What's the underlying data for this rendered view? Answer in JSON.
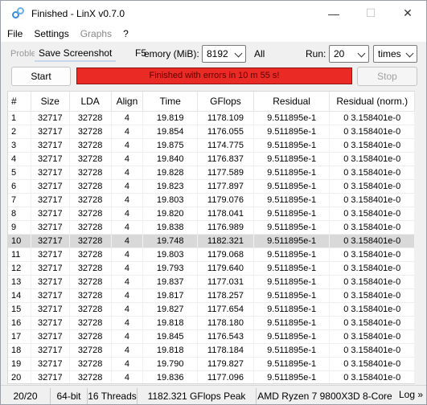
{
  "window": {
    "title": "Finished - LinX v0.7.0",
    "controls": {
      "minimize": "—",
      "maximize": "☐",
      "close": "✕"
    }
  },
  "menu": [
    "File",
    "Settings",
    "Graphs",
    "?"
  ],
  "toolbar": {
    "ghost_left": "Proble",
    "save_screenshot": "Save Screenshot",
    "shortcut": "F5",
    "memory_label": "emory (MiB):",
    "memory_value": "8192",
    "all_label": "All",
    "run_label": "Run:",
    "run_value": "20",
    "times_value": "times"
  },
  "actions": {
    "start": "Start",
    "status": "Finished with errors in 10 m 55 s!",
    "stop": "Stop"
  },
  "table": {
    "headers": [
      "#",
      "Size",
      "LDA",
      "Align",
      "Time",
      "GFlops",
      "Residual",
      "Residual (norm.)"
    ],
    "selected_row": 10,
    "rows": [
      [
        "1",
        "32717",
        "32728",
        "4",
        "19.819",
        "1178.109",
        "9.511895e-1",
        "0 3.158401e-0"
      ],
      [
        "2",
        "32717",
        "32728",
        "4",
        "19.854",
        "1176.055",
        "9.511895e-1",
        "0 3.158401e-0"
      ],
      [
        "3",
        "32717",
        "32728",
        "4",
        "19.875",
        "1174.775",
        "9.511895e-1",
        "0 3.158401e-0"
      ],
      [
        "4",
        "32717",
        "32728",
        "4",
        "19.840",
        "1176.837",
        "9.511895e-1",
        "0 3.158401e-0"
      ],
      [
        "5",
        "32717",
        "32728",
        "4",
        "19.828",
        "1177.589",
        "9.511895e-1",
        "0 3.158401e-0"
      ],
      [
        "6",
        "32717",
        "32728",
        "4",
        "19.823",
        "1177.897",
        "9.511895e-1",
        "0 3.158401e-0"
      ],
      [
        "7",
        "32717",
        "32728",
        "4",
        "19.803",
        "1179.076",
        "9.511895e-1",
        "0 3.158401e-0"
      ],
      [
        "8",
        "32717",
        "32728",
        "4",
        "19.820",
        "1178.041",
        "9.511895e-1",
        "0 3.158401e-0"
      ],
      [
        "9",
        "32717",
        "32728",
        "4",
        "19.838",
        "1176.989",
        "9.511895e-1",
        "0 3.158401e-0"
      ],
      [
        "10",
        "32717",
        "32728",
        "4",
        "19.748",
        "1182.321",
        "9.511895e-1",
        "0 3.158401e-0"
      ],
      [
        "11",
        "32717",
        "32728",
        "4",
        "19.803",
        "1179.068",
        "9.511895e-1",
        "0 3.158401e-0"
      ],
      [
        "12",
        "32717",
        "32728",
        "4",
        "19.793",
        "1179.640",
        "9.511895e-1",
        "0 3.158401e-0"
      ],
      [
        "13",
        "32717",
        "32728",
        "4",
        "19.837",
        "1177.031",
        "9.511895e-1",
        "0 3.158401e-0"
      ],
      [
        "14",
        "32717",
        "32728",
        "4",
        "19.817",
        "1178.257",
        "9.511895e-1",
        "0 3.158401e-0"
      ],
      [
        "15",
        "32717",
        "32728",
        "4",
        "19.827",
        "1177.654",
        "9.511895e-1",
        "0 3.158401e-0"
      ],
      [
        "16",
        "32717",
        "32728",
        "4",
        "19.818",
        "1178.180",
        "9.511895e-1",
        "0 3.158401e-0"
      ],
      [
        "17",
        "32717",
        "32728",
        "4",
        "19.845",
        "1176.543",
        "9.511895e-1",
        "0 3.158401e-0"
      ],
      [
        "18",
        "32717",
        "32728",
        "4",
        "19.818",
        "1178.184",
        "9.511895e-1",
        "0 3.158401e-0"
      ],
      [
        "19",
        "32717",
        "32728",
        "4",
        "19.790",
        "1179.827",
        "9.511895e-1",
        "0 3.158401e-0"
      ],
      [
        "20",
        "32717",
        "32728",
        "4",
        "19.836",
        "1177.096",
        "9.511895e-1",
        "0 3.158401e-0"
      ]
    ]
  },
  "statusbar": {
    "progress": "20/20",
    "arch": "64-bit",
    "threads": "16 Threads",
    "peak": "1182.321 GFlops Peak",
    "cpu": "AMD Ryzen 7 9800X3D 8-Core",
    "log": "Log »"
  },
  "colors": {
    "status_error": "#ea2a24",
    "selected_row": "#d9d9d9"
  }
}
